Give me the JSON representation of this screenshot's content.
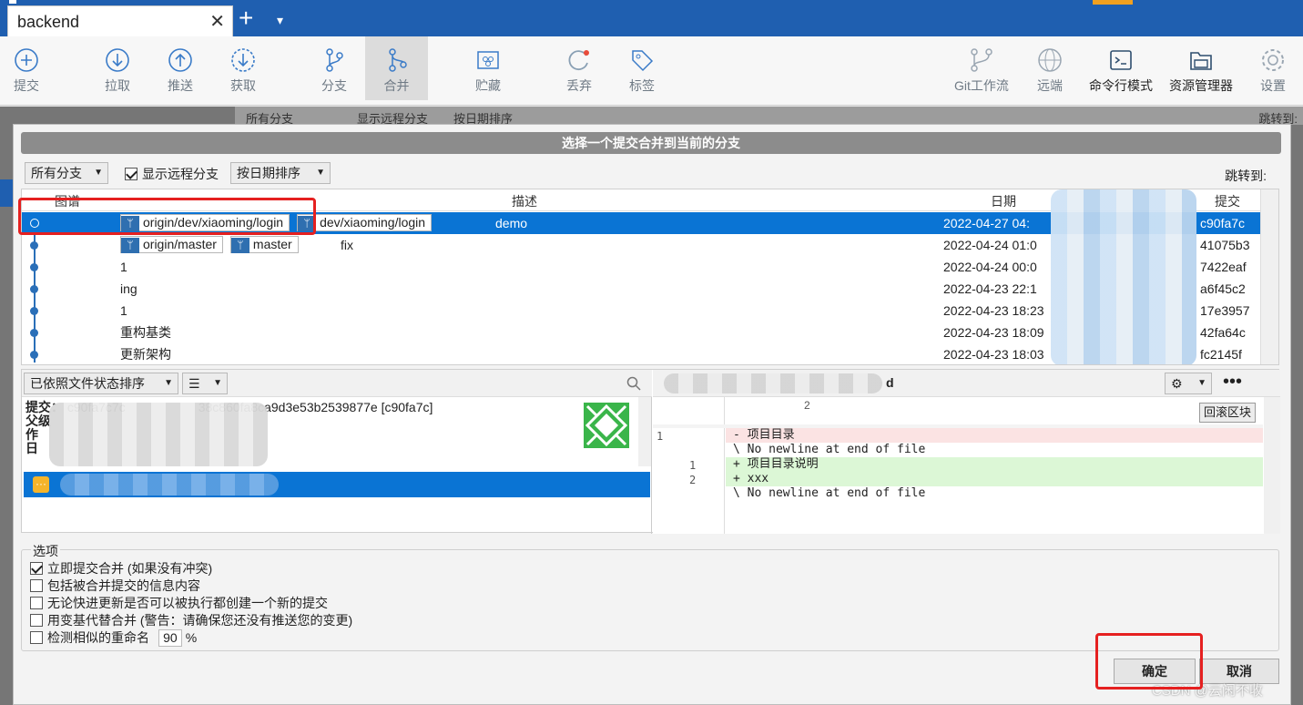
{
  "window": {
    "tab_title": "backend",
    "new_tab": "+",
    "tab_menu": "▾",
    "close": "✕"
  },
  "toolbar": {
    "items": [
      {
        "label": "提交"
      },
      {
        "label": "拉取"
      },
      {
        "label": "推送"
      },
      {
        "label": "获取"
      },
      {
        "label": "分支"
      },
      {
        "label": "合并"
      },
      {
        "label": "贮藏"
      },
      {
        "label": "丢弃"
      },
      {
        "label": "标签"
      },
      {
        "label": "Git工作流"
      },
      {
        "label": "远端"
      },
      {
        "label": "命令行模式"
      },
      {
        "label": "资源管理器"
      },
      {
        "label": "设置"
      }
    ]
  },
  "background": {
    "branch_filter": "所有分支",
    "show_remote": "显示远程分支",
    "sort": "按日期排序",
    "jump": "跳转到:"
  },
  "dialog": {
    "title": "选择一个提交合并到当前的分支",
    "branch_filter": "所有分支",
    "show_remote": "显示远程分支",
    "sort": "按日期排序",
    "jump_to": "跳转到:",
    "columns": {
      "graph": "图谱",
      "desc": "描述",
      "date": "日期",
      "commit": "提交"
    },
    "commits": [
      {
        "refs": [
          "origin/dev/xiaoming/login",
          "dev/xiaoming/login"
        ],
        "message": "demo",
        "date": "2022-04-27 04:",
        "hash": "c90fa7c"
      },
      {
        "refs": [
          "origin/master",
          "master"
        ],
        "message": "fix",
        "date": "2022-04-24 01:0",
        "hash": "41075b3"
      },
      {
        "refs": [],
        "message": "1",
        "date": "2022-04-24 00:0",
        "hash": "7422eaf"
      },
      {
        "refs": [],
        "message": "ing",
        "date": "2022-04-23 22:1",
        "hash": "a6f45c2"
      },
      {
        "refs": [],
        "message": "1",
        "date": "2022-04-23 18:23",
        "hash": "17e3957"
      },
      {
        "refs": [],
        "message": "重构基类",
        "date": "2022-04-23 18:09",
        "hash": "42fa64c"
      },
      {
        "refs": [],
        "message": "更新架构",
        "date": "2022-04-23 18:03",
        "hash": "fc2145f"
      }
    ],
    "file_sort": "已依照文件状态排序",
    "details": {
      "commit_label": "提交：",
      "commit_value": "c90fa7c7c",
      "commit_tail": "38c860fa8ca9d3e53b2539877e [c90fa7c]",
      "parent_label": "父级",
      "author_label": "作",
      "date_label": "日",
      "file_badge": "···"
    },
    "diff": {
      "hunk_label": "d",
      "hunk_sub": "2",
      "revert_hunk": "回滚区块",
      "lines": [
        {
          "old": "1",
          "new": "",
          "text": "- 项目目录",
          "type": "del"
        },
        {
          "old": "",
          "new": "",
          "text": "\\  No newline at end of file",
          "type": "ctx"
        },
        {
          "old": "",
          "new": "1",
          "text": "+ 项目目录说明",
          "type": "add"
        },
        {
          "old": "",
          "new": "2",
          "text": "+ xxx",
          "type": "add"
        },
        {
          "old": "",
          "new": "",
          "text": "\\  No newline at end of file",
          "type": "ctx"
        }
      ]
    },
    "options": {
      "legend": "选项",
      "items": [
        {
          "label": "立即提交合并 (如果没有冲突)",
          "checked": true
        },
        {
          "label": "包括被合并提交的信息内容",
          "checked": false
        },
        {
          "label": "无论快进更新是否可以被执行都创建一个新的提交",
          "checked": false
        },
        {
          "label": "用变基代替合并 (警告：请确保您还没有推送您的变更)",
          "checked": false
        },
        {
          "label": "检测相似的重命名",
          "checked": false
        }
      ],
      "rename_value": "90",
      "rename_unit": "%"
    },
    "ok": "确定",
    "cancel": "取消",
    "watermark": "CSDN @云闲不收"
  }
}
